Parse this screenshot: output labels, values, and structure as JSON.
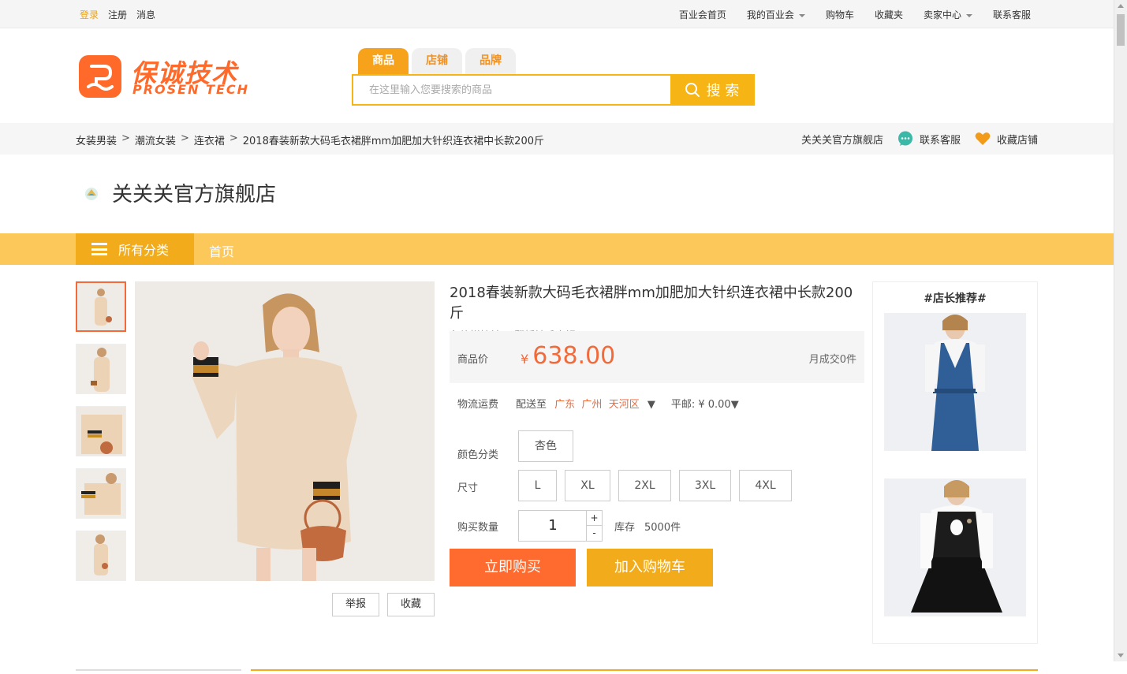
{
  "topbar": {
    "login": "登录",
    "register": "注册",
    "messages": "消息",
    "home": "百业会首页",
    "my": "我的百业会",
    "cart": "购物车",
    "favorites": "收藏夹",
    "seller": "卖家中心",
    "service": "联系客服"
  },
  "logo": {
    "cn": "保诚技术",
    "en": "PROSEN TECH"
  },
  "search": {
    "tabs": [
      "商品",
      "店铺",
      "品牌"
    ],
    "placeholder": "在这里输入您要搜索的商品",
    "button": "搜 索"
  },
  "breadcrumb": {
    "items": [
      "女装男装",
      "潮流女装",
      "连衣裙",
      "2018春装新款大码毛衣裙胖mm加肥加大针织连衣裙中长款200斤"
    ],
    "sep": ">",
    "store": "关关关官方旗舰店",
    "contact": "联系客服",
    "favorite_store": "收藏店铺"
  },
  "store": {
    "name": "关关关官方旗舰店"
  },
  "nav": {
    "all": "所有分类",
    "home": "首页"
  },
  "gallery": {
    "report": "举报",
    "collect": "收藏"
  },
  "product": {
    "title": "2018春装新款大码毛衣裙胖mm加肥加大针织连衣裙中长款200斤",
    "subtitle": "条纹拼接袖口 翻折袖毛衣裙",
    "price_label": "商品价",
    "currency": "¥",
    "price": "638.00",
    "monthly_sales": "月成交0件",
    "shipping_label": "物流运费",
    "ship_to": "配送至",
    "location": "广东  广州  天河区",
    "ship_caret": "▼",
    "postage": "平邮: ¥ 0.00▼",
    "color_label": "颜色分类",
    "colors": [
      "杏色"
    ],
    "size_label": "尺寸",
    "sizes": [
      "L",
      "XL",
      "2XL",
      "3XL",
      "4XL"
    ],
    "qty_label": "购买数量",
    "qty": "1",
    "plus": "+",
    "minus": "-",
    "stock_label": "库存",
    "stock": "5000件",
    "buy_now": "立即购买",
    "add_cart": "加入购物车"
  },
  "recommend": {
    "title": "#店长推荐#"
  },
  "colors": {
    "accent": "#f2ac1b",
    "price": "#f2693a",
    "nav": "#fdc85a"
  }
}
